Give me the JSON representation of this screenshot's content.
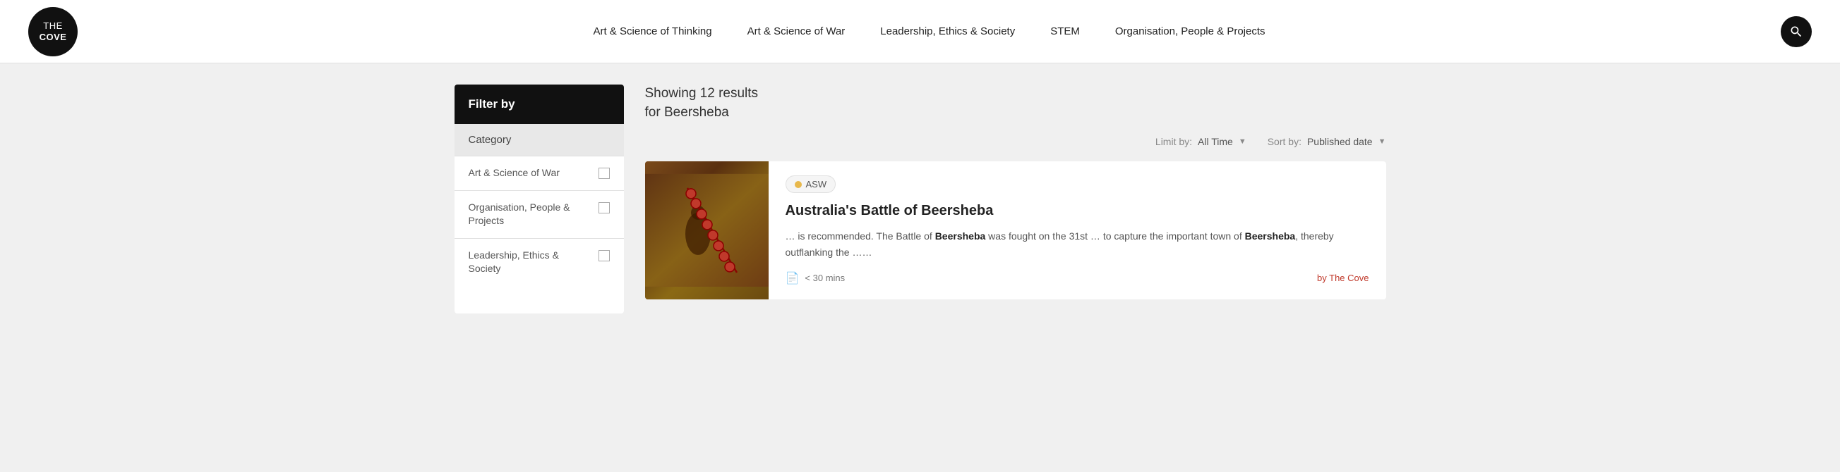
{
  "header": {
    "logo_the": "THE",
    "logo_cove": "COVE",
    "nav_items": [
      {
        "label": "Art & Science of Thinking"
      },
      {
        "label": "Art & Science of War"
      },
      {
        "label": "Leadership, Ethics & Society"
      },
      {
        "label": "STEM"
      },
      {
        "label": "Organisation, People & Projects"
      }
    ]
  },
  "sidebar": {
    "filter_header": "Filter by",
    "category_label": "Category",
    "filter_items": [
      {
        "label": "Art & Science of War"
      },
      {
        "label": "Organisation, People & Projects"
      },
      {
        "label": "Leadership, Ethics & Society"
      }
    ]
  },
  "results": {
    "showing_text": "Showing 12 results",
    "query_text": "for Beersheba",
    "limit_label": "Limit by:",
    "limit_value": "All Time",
    "sort_label": "Sort by:",
    "sort_value": "Published date",
    "cards": [
      {
        "tag": "ASW",
        "title": "Australia's Battle of Beersheba",
        "excerpt_pre": "… is recommended. The Battle of ",
        "excerpt_bold1": "Beersheba",
        "excerpt_mid": " was fought on the 31st … to capture the important town of ",
        "excerpt_bold2": "Beersheba",
        "excerpt_post": ", thereby outflanking the ……",
        "duration": "< 30 mins",
        "author": "by The Cove"
      }
    ]
  }
}
